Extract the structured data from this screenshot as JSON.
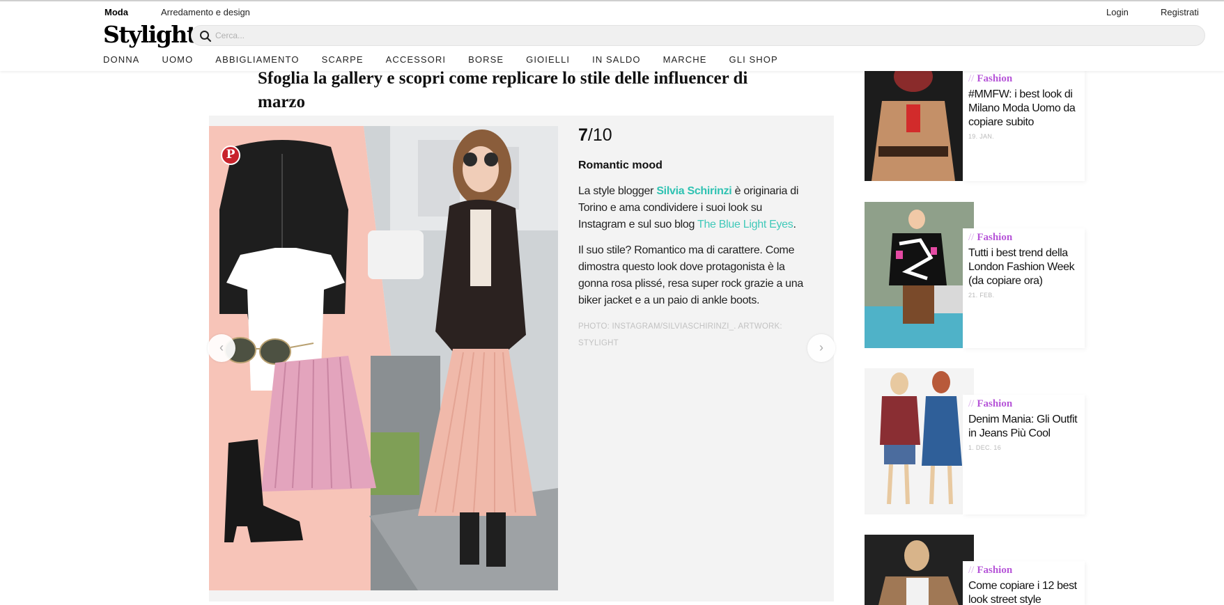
{
  "header": {
    "section_tabs": [
      "Moda",
      "Arredamento e design"
    ],
    "logo": "Stylight",
    "search_placeholder": "Cerca...",
    "login": "Login",
    "register": "Registrati",
    "nav": [
      "DONNA",
      "UOMO",
      "ABBIGLIAMENTO",
      "SCARPE",
      "ACCESSORI",
      "BORSE",
      "GIOIELLI",
      "IN SALDO",
      "MARCHE",
      "GLI SHOP"
    ]
  },
  "article": {
    "headline": "Sfoglia la gallery e scopri come replicare lo stile delle influencer di marzo",
    "gallery": {
      "pin_icon": "pinterest-icon",
      "counter_current": "7",
      "counter_total": "/10",
      "slide_title": "Romantic mood",
      "p1_before": "La style blogger ",
      "p1_name": "Silvia Schirinzi",
      "p1_middle": " è originaria di Torino e ama condividere i suoi look su Instagram e sul suo blog ",
      "p1_blog": "The Blue Light Eyes",
      "p1_after": ".",
      "p2": "Il suo stile? Romantico ma di carattere. Come dimostra questo look dove protagonista è la gonna rosa plissé, resa super rock grazie a una biker jacket e a un paio di ankle boots.",
      "credit": "PHOTO: INSTAGRAM/SILVIASCHIRINZI_. ARTWORK: STYLIGHT",
      "prev_icon": "chevron-left-icon",
      "next_icon": "chevron-right-icon"
    }
  },
  "sidebar": [
    {
      "category": "Fashion",
      "title": "#MMFW: i best look di Milano Moda Uomo da copiare subito",
      "date": "19. JAN."
    },
    {
      "category": "Fashion",
      "title": "Tutti i best trend della London Fashion Week (da copiare ora)",
      "date": "21. FEB."
    },
    {
      "category": "Fashion",
      "title": "Denim Mania: Gli Outfit in Jeans Più Cool",
      "date": "1. DEC. 16"
    },
    {
      "category": "Fashion",
      "title": "Come copiare i 12 best look street style",
      "date": ""
    }
  ],
  "colors": {
    "accent_link": "#2fc2b2",
    "category": "#b655d8",
    "gallery_bg": "#f3f3f3",
    "collage_pink": "#f7c4b8"
  }
}
